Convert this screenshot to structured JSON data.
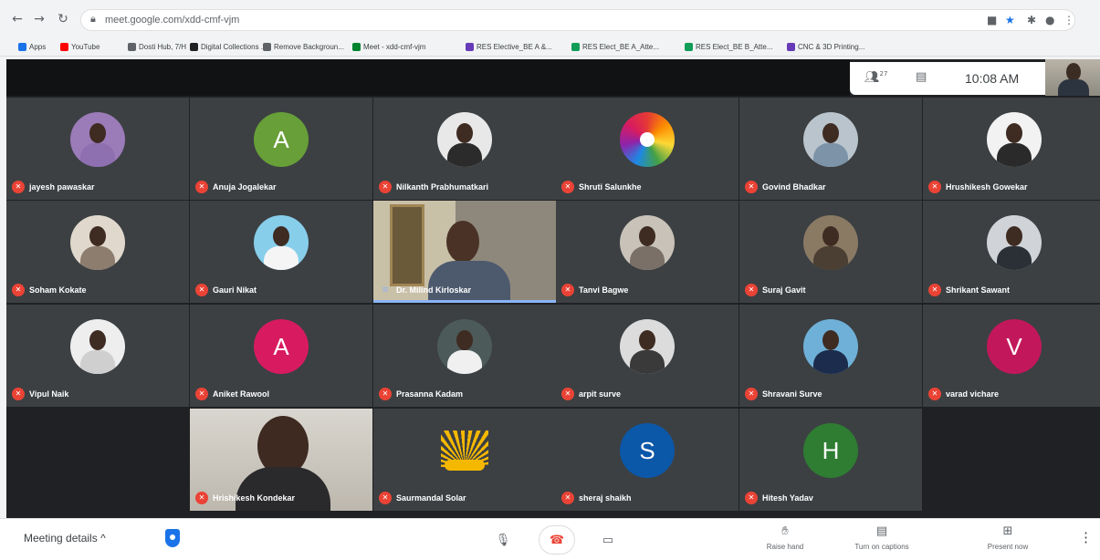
{
  "browser": {
    "url": "meet.google.com/xdd-cmf-vjm",
    "bookmarks": [
      {
        "label": "Apps",
        "color": "#1a73e8"
      },
      {
        "label": "YouTube",
        "color": "#ff0000"
      },
      {
        "label": "Dosti Hub, 7/H",
        "color": "#5f6368"
      },
      {
        "label": "Digital Collections ...",
        "color": "#202124"
      },
      {
        "label": "Remove Backgroun...",
        "color": "#5f6368"
      },
      {
        "label": "Meet - xdd-cmf-vjm",
        "color": "#00832d"
      },
      {
        "label": "RES Elective_BE A &...",
        "color": "#673ab7"
      },
      {
        "label": "RES Elect_BE A_Atte...",
        "color": "#0f9d58"
      },
      {
        "label": "RES Elect_BE B_Atte...",
        "color": "#0f9d58"
      },
      {
        "label": "CNC & 3D Printing...",
        "color": "#673ab7"
      }
    ]
  },
  "meeting": {
    "participant_count": "27",
    "time": "10:08 AM",
    "participants": [
      {
        "name": "jayesh pawaskar",
        "type": "photo",
        "bg": "#9b7bb8",
        "shirt": "#8e6fb0",
        "mic": "off"
      },
      {
        "name": "Anuja Jogalekar",
        "type": "initial",
        "initial": "A",
        "bg": "#689f38",
        "mic": "off"
      },
      {
        "name": "Nilkanth Prabhumatkari",
        "type": "photo",
        "bg": "#e8e8e8",
        "shirt": "#2b2b2b",
        "mic": "off"
      },
      {
        "name": "Shruti Salunkhe",
        "type": "flower",
        "bg": "#ffffff",
        "mic": "off"
      },
      {
        "name": "Govind Bhadkar",
        "type": "photo",
        "bg": "#b9c4cc",
        "shirt": "#7d93a8",
        "mic": "off"
      },
      {
        "name": "Hrushikesh Gowekar",
        "type": "photo",
        "bg": "#f2f2f2",
        "shirt": "#2a2a2a",
        "mic": "off"
      },
      {
        "name": "Soham Kokate",
        "type": "photo",
        "bg": "#e0d8cc",
        "shirt": "#8c7d6e",
        "mic": "off"
      },
      {
        "name": "Gauri Nikat",
        "type": "photo",
        "bg": "#87ceeb",
        "shirt": "#f5f5f5",
        "mic": "off"
      },
      {
        "name": "Dr. Milind Kirloskar",
        "type": "video",
        "mic": "on"
      },
      {
        "name": "Tanvi Bagwe",
        "type": "photo",
        "bg": "#c9c2b8",
        "shirt": "#7a7068",
        "mic": "off"
      },
      {
        "name": "Suraj Gavit",
        "type": "photo",
        "bg": "#8a7a64",
        "shirt": "#4b3f33",
        "mic": "off"
      },
      {
        "name": "Shrikant Sawant",
        "type": "photo",
        "bg": "#d0d4d8",
        "shirt": "#2b3036",
        "mic": "off"
      },
      {
        "name": "Vipul Naik",
        "type": "photo",
        "bg": "#eeeeee",
        "shirt": "#cfcfcf",
        "mic": "off"
      },
      {
        "name": "Aniket Rawool",
        "type": "initial",
        "initial": "A",
        "bg": "#d81b60",
        "mic": "off"
      },
      {
        "name": "Prasanna Kadam",
        "type": "photo",
        "bg": "#4d5a5a",
        "shirt": "#f0f0f0",
        "mic": "off"
      },
      {
        "name": "arpit surve",
        "type": "photo",
        "bg": "#dcdcdc",
        "shirt": "#3a3a3a",
        "mic": "off"
      },
      {
        "name": "Shravani Surve",
        "type": "photo",
        "bg": "#6fb0d8",
        "shirt": "#1c2c4c",
        "mic": "off"
      },
      {
        "name": "varad vichare",
        "type": "initial",
        "initial": "V",
        "bg": "#c2185b",
        "mic": "off"
      },
      {
        "name": "Hrishikesh Kondekar",
        "type": "video2",
        "mic": "off"
      },
      {
        "name": "Saurmandal Solar",
        "type": "sun",
        "bg": "#202124",
        "mic": "off"
      },
      {
        "name": "sheraj shaikh",
        "type": "initial",
        "initial": "S",
        "bg": "#0b57a8",
        "mic": "off"
      },
      {
        "name": "Hitesh Yadav",
        "type": "initial",
        "initial": "H",
        "bg": "#2e7d32",
        "mic": "off"
      }
    ]
  },
  "bottom": {
    "meeting_details": "Meeting details",
    "raise_hand": "Raise hand",
    "captions": "Turn on captions",
    "present": "Present now"
  }
}
